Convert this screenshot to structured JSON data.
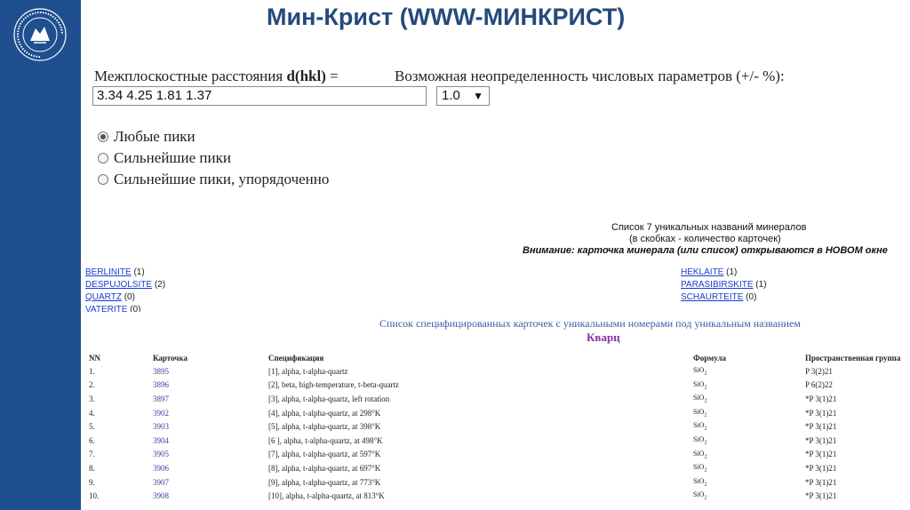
{
  "slide_title": "Мин-Крист (WWW-МИНКРИСТ)",
  "form": {
    "dhkl_label": "Межплоскостные расстояния",
    "dhkl_bold": "d(hkl)",
    "dhkl_eq": "=",
    "dhkl_value": "3.34 4.25 1.81 1.37",
    "uncertainty_label": "Возможная неопределенность числовых параметров (+/- %):",
    "uncertainty_value": "1.0",
    "radios": [
      {
        "label": "Любые пики",
        "checked": true
      },
      {
        "label": "Сильнейшие пики",
        "checked": false
      },
      {
        "label": "Сильнейшие пики, упорядоченно",
        "checked": false
      }
    ]
  },
  "list_header": {
    "title": "Список 7 уникальных названий минералов",
    "subtitle": "(в скобках - количество карточек)",
    "warning": "Внимание: карточка минерала (или список) открываются в НОВОМ окне"
  },
  "minerals_left": [
    {
      "name": "BERLINITE",
      "count": "(1)"
    },
    {
      "name": "DESPUJOLSITE",
      "count": "(2)"
    },
    {
      "name": "QUARTZ",
      "count": "(0)"
    },
    {
      "name": "VATERITE",
      "count": "(0)"
    }
  ],
  "minerals_right": [
    {
      "name": "HEKLAITE",
      "count": "(1)"
    },
    {
      "name": "PARASIBIRSKITE",
      "count": "(1)"
    },
    {
      "name": "SCHAURTEITE",
      "count": "(0)"
    }
  ],
  "spec_title": "Список специфицированных карточек с уникальными номерами под уникальным названием",
  "spec_mineral": "Кварц",
  "table": {
    "headers": [
      "NN",
      "Карточка",
      "Спецификация",
      "Формула",
      "Пространственная группа"
    ],
    "rows": [
      {
        "nn": "1.",
        "card": "3895",
        "spec": "[1], alpha, t-alpha-quartz",
        "f_base": "SiO",
        "f_sub": "2",
        "group": "P 3(2)21"
      },
      {
        "nn": "2.",
        "card": "3896",
        "spec": "[2], beta, high-temperature, t-beta-quartz",
        "f_base": "SiO",
        "f_sub": "2",
        "group": "P 6(2)22"
      },
      {
        "nn": "3.",
        "card": "3897",
        "spec": "[3], alpha, t-alpha-quartz, left rotation",
        "f_base": "SiO",
        "f_sub": "2",
        "group": "*P 3(1)21"
      },
      {
        "nn": "4.",
        "card": "3902",
        "spec": "[4], alpha, t-alpha-quartz, at 298°K",
        "f_base": "SiO",
        "f_sub": "2",
        "group": "*P 3(1)21"
      },
      {
        "nn": "5.",
        "card": "3903",
        "spec": "[5], alpha, t-alpha-quartz, at 398°K",
        "f_base": "SiO",
        "f_sub": "2",
        "group": "*P 3(1)21"
      },
      {
        "nn": "6.",
        "card": "3904",
        "spec": "[6 ], alpha, t-alpha-quartz, at 498°K",
        "f_base": "SiO",
        "f_sub": "2",
        "group": "*P 3(1)21"
      },
      {
        "nn": "7.",
        "card": "3905",
        "spec": "[7], alpha, t-alpha-quartz, at 597°K",
        "f_base": "SiO",
        "f_sub": "2",
        "group": "*P 3(1)21"
      },
      {
        "nn": "8.",
        "card": "3906",
        "spec": "[8], alpha, t-alpha-quartz, at 697°K",
        "f_base": "SiO",
        "f_sub": "2",
        "group": "*P 3(1)21"
      },
      {
        "nn": "9.",
        "card": "3907",
        "spec": "[9], alpha, t-alpha-quartz, at 773°K",
        "f_base": "SiO",
        "f_sub": "2",
        "group": "*P 3(1)21"
      },
      {
        "nn": "10.",
        "card": "3908",
        "spec": "[10], alpha, t-alpha-quartz, at 813°K",
        "f_base": "SiO",
        "f_sub": "2",
        "group": "*P 3(1)21"
      }
    ]
  },
  "logo_text": "КАЗАНСКИЙ ФЕДЕРАЛЬНЫЙ УНИВЕРСИТЕТ",
  "colors": {
    "sidebar": "#1f4f8f",
    "title": "#244a7c",
    "link": "#1a3ccf",
    "mineral_heading": "#8a2fa6"
  }
}
